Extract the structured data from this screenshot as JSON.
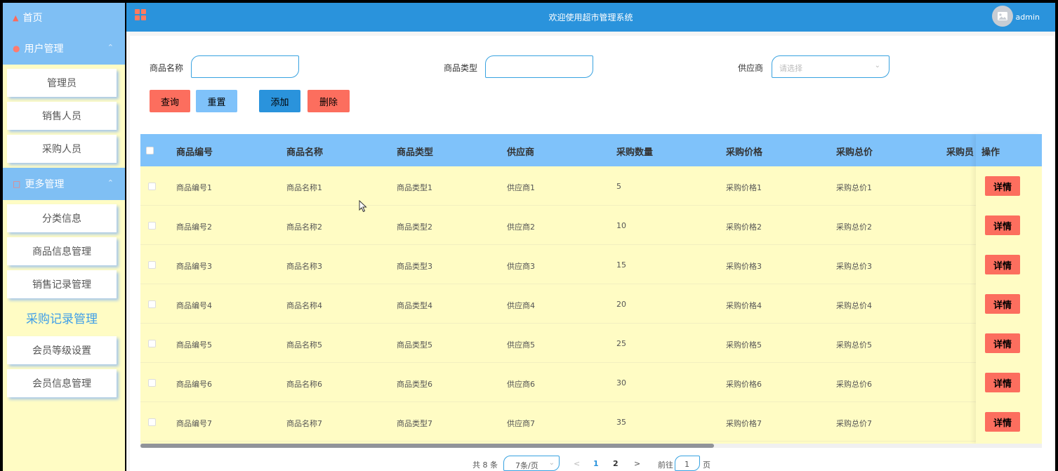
{
  "sidebar": {
    "home": "首页",
    "groups": [
      {
        "title": "用户管理",
        "items": [
          "管理员",
          "销售人员",
          "采购人员"
        ]
      },
      {
        "title": "更多管理",
        "items": [
          "分类信息",
          "商品信息管理",
          "销售记录管理",
          "采购记录管理",
          "会员等级设置",
          "会员信息管理"
        ]
      }
    ],
    "active_item": "采购记录管理"
  },
  "header": {
    "title": "欢迎使用超市管理系统",
    "user": "admin"
  },
  "search": {
    "name_label": "商品名称",
    "name_value": "",
    "type_label": "商品类型",
    "type_value": "",
    "supplier_label": "供应商",
    "supplier_placeholder": "请选择"
  },
  "buttons": {
    "query": "查询",
    "reset": "重置",
    "add": "添加",
    "delete": "删除"
  },
  "colors": {
    "header": "#2a93dc",
    "sidebar": "#fffcc4",
    "sidebar_head": "#7fbff4",
    "table_head": "#7fc2fa",
    "danger": "#fc6e5e",
    "primary": "#2a93dc"
  },
  "table": {
    "columns": [
      "商品编号",
      "商品名称",
      "商品类型",
      "供应商",
      "采购数量",
      "采购价格",
      "采购总价",
      "采购员"
    ],
    "action_header": "操作",
    "detail_label": "详情",
    "rows": [
      [
        "商品编号1",
        "商品名称1",
        "商品类型1",
        "供应商1",
        "5",
        "采购价格1",
        "采购总价1",
        ""
      ],
      [
        "商品编号2",
        "商品名称2",
        "商品类型2",
        "供应商2",
        "10",
        "采购价格2",
        "采购总价2",
        ""
      ],
      [
        "商品编号3",
        "商品名称3",
        "商品类型3",
        "供应商3",
        "15",
        "采购价格3",
        "采购总价3",
        ""
      ],
      [
        "商品编号4",
        "商品名称4",
        "商品类型4",
        "供应商4",
        "20",
        "采购价格4",
        "采购总价4",
        ""
      ],
      [
        "商品编号5",
        "商品名称5",
        "商品类型5",
        "供应商5",
        "25",
        "采购价格5",
        "采购总价5",
        ""
      ],
      [
        "商品编号6",
        "商品名称6",
        "商品类型6",
        "供应商6",
        "30",
        "采购价格6",
        "采购总价6",
        ""
      ],
      [
        "商品编号7",
        "商品名称7",
        "商品类型7",
        "供应商7",
        "35",
        "采购价格7",
        "采购总价7",
        ""
      ]
    ]
  },
  "pagination": {
    "total": "共 8 条",
    "page_size": "7条/页",
    "pages": [
      "1",
      "2"
    ],
    "current_page": "1",
    "goto_prefix": "前往",
    "goto_value": "1",
    "goto_suffix": "页"
  }
}
